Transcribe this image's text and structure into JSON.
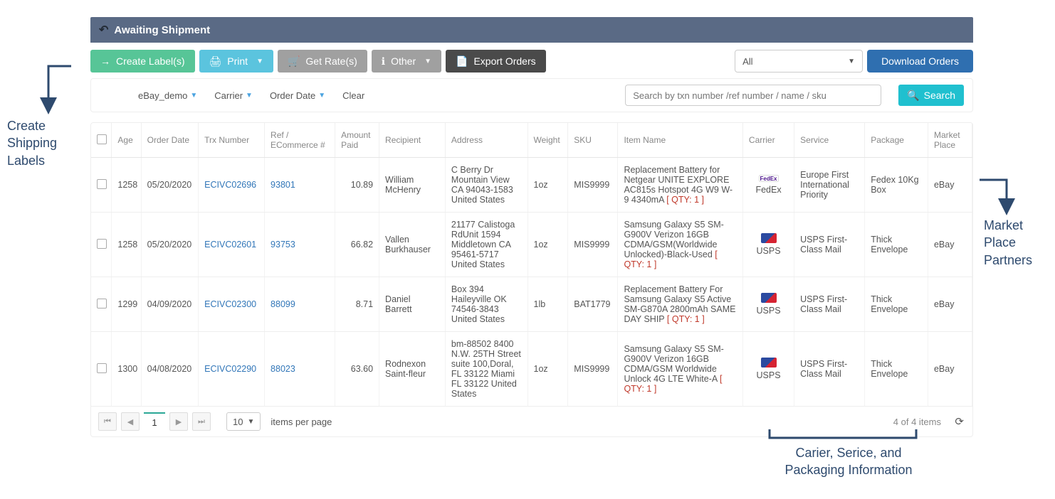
{
  "header": {
    "title": "Awaiting Shipment"
  },
  "toolbar": {
    "create_label": "Create Label(s)",
    "print": "Print",
    "get_rates": "Get Rate(s)",
    "other": "Other",
    "export": "Export Orders",
    "all_option": "All",
    "download": "Download Orders"
  },
  "filters": {
    "store": "eBay_demo",
    "carrier": "Carrier",
    "order_date": "Order Date",
    "clear": "Clear",
    "search_placeholder": "Search by txn number /ref number / name / sku",
    "search_btn": "Search"
  },
  "columns": {
    "age": "Age",
    "order_date": "Order Date",
    "trx": "Trx Number",
    "ref": "Ref / ECommerce #",
    "amount": "Amount Paid",
    "recipient": "Recipient",
    "address": "Address",
    "weight": "Weight",
    "sku": "SKU",
    "item": "Item Name",
    "carrier": "Carrier",
    "service": "Service",
    "package": "Package",
    "market": "Market Place"
  },
  "rows": [
    {
      "age": "1258",
      "order_date": "05/20/2020",
      "trx": "ECIVC02696",
      "ref": "93801",
      "amount": "10.89",
      "recipient": "William McHenry",
      "address": "C Berry Dr Mountain View CA 94043-1583 United States",
      "weight": "1oz",
      "sku": "MIS9999",
      "item": "Replacement Battery for Netgear UNITE EXPLORE AC815s Hotspot 4G W9 W-9 4340mA",
      "qty": "[ QTY: 1 ]",
      "carrier": "FedEx",
      "carrier_kind": "fedex",
      "service": "Europe First International Priority",
      "package": "Fedex 10Kg Box",
      "market": "eBay"
    },
    {
      "age": "1258",
      "order_date": "05/20/2020",
      "trx": "ECIVC02601",
      "ref": "93753",
      "amount": "66.82",
      "recipient": "Vallen Burkhauser",
      "address": "21177 Calistoga RdUnit 1594 Middletown CA 95461-5717 United States",
      "weight": "1oz",
      "sku": "MIS9999",
      "item": "Samsung Galaxy S5 SM-G900V Verizon 16GB CDMA/GSM(Worldwide Unlocked)-Black-Used",
      "qty": "[ QTY: 1 ]",
      "carrier": "USPS",
      "carrier_kind": "usps",
      "service": "USPS First-Class Mail",
      "package": "Thick Envelope",
      "market": "eBay"
    },
    {
      "age": "1299",
      "order_date": "04/09/2020",
      "trx": "ECIVC02300",
      "ref": "88099",
      "amount": "8.71",
      "recipient": "Daniel Barrett",
      "address": "Box 394 Haileyville OK 74546-3843 United States",
      "weight": "1lb",
      "sku": "BAT1779",
      "item": "Replacement Battery For Samsung Galaxy S5 Active SM-G870A 2800mAh SAME DAY SHIP",
      "qty": "[ QTY: 1 ]",
      "carrier": "USPS",
      "carrier_kind": "usps",
      "service": "USPS First-Class Mail",
      "package": "Thick Envelope",
      "market": "eBay"
    },
    {
      "age": "1300",
      "order_date": "04/08/2020",
      "trx": "ECIVC02290",
      "ref": "88023",
      "amount": "63.60",
      "recipient": "Rodnexon Saint-fleur",
      "address": "bm-88502 8400 N.W. 25TH Street suite 100,Doral, FL 33122 Miami FL 33122 United States",
      "weight": "1oz",
      "sku": "MIS9999",
      "item": "Samsung Galaxy S5 SM-G900V Verizon 16GB CDMA/GSM Worldwide Unlock 4G LTE White-A",
      "qty": "[ QTY: 1 ]",
      "carrier": "USPS",
      "carrier_kind": "usps",
      "service": "USPS First-Class Mail",
      "package": "Thick Envelope",
      "market": "eBay"
    }
  ],
  "pager": {
    "page": "1",
    "per_page": "10",
    "per_page_label": "items per page",
    "count": "4 of 4 items"
  },
  "callouts": {
    "labels": "Create\nShipping\nLabels",
    "market": "Market\nPlace\nPartners",
    "carrier": "Carier, Serice, and\nPackaging Information"
  }
}
